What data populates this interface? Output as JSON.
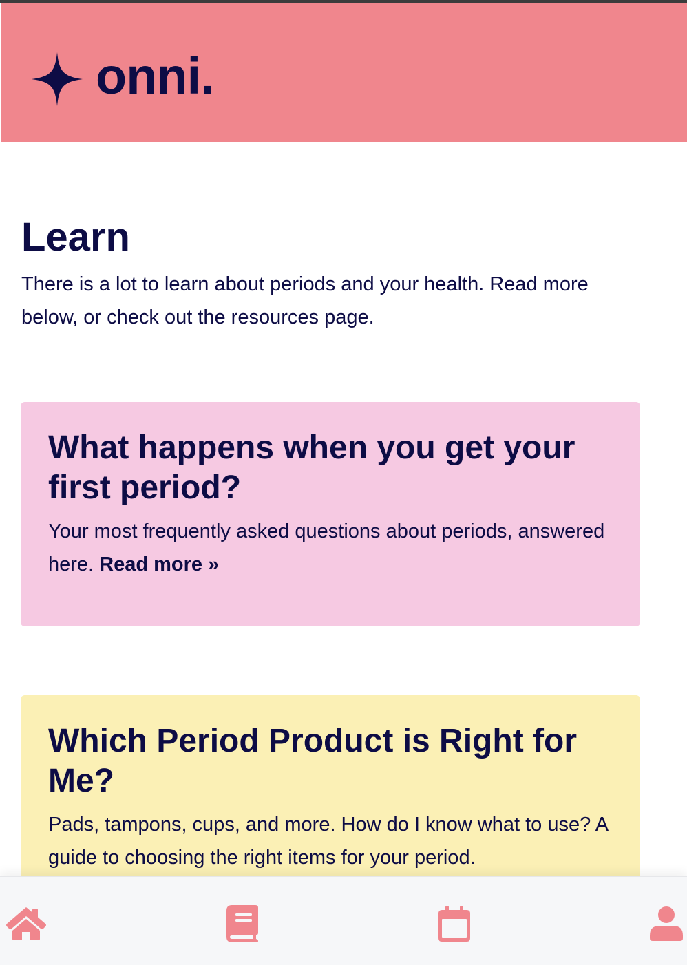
{
  "header": {
    "logo_text": "onni.",
    "logo_icon": "sparkle-star-icon",
    "background_color": "#f0868d"
  },
  "main": {
    "title": "Learn",
    "intro": "There is a lot to learn about periods and your health. Read more below, or check out the resources page.",
    "cards": [
      {
        "title": "What happens when you get your first period?",
        "text": "Your most frequently asked questions about periods, answered here.",
        "link_label": "Read more »",
        "background_color": "#f6c9e2"
      },
      {
        "title": "Which Period Product is Right for Me?",
        "text": "Pads, tampons, cups, and more. How do I know what to use? A guide to choosing the right items for your period.",
        "background_color": "#fbf0b5"
      }
    ]
  },
  "bottom_nav": {
    "accent_color": "#f0868d",
    "items": [
      {
        "icon": "home-icon"
      },
      {
        "icon": "book-icon"
      },
      {
        "icon": "calendar-icon"
      },
      {
        "icon": "user-icon"
      }
    ]
  },
  "colors": {
    "text": "#0d0c45"
  }
}
